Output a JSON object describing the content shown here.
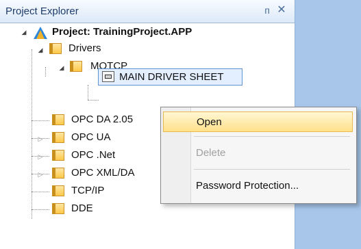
{
  "panel": {
    "title": "Project Explorer",
    "pin_icon": "pin-icon",
    "close_icon": "close-icon",
    "pin_glyph": "ᴨ",
    "close_glyph": "✕"
  },
  "tree": {
    "project_label": "Project: TrainingProject.APP",
    "drivers_label": "Drivers",
    "motcp_label": "MOTCP",
    "main_sheet_label": "MAIN DRIVER SHEET",
    "opc_da_label": "OPC DA 2.05",
    "opc_ua_label": "OPC UA",
    "opc_net_label": "OPC .Net",
    "opc_xmlda_label": "OPC XML/DA",
    "tcpip_label": "TCP/IP",
    "dde_label": "DDE"
  },
  "context_menu": {
    "open_label": "Open",
    "delete_label": "Delete",
    "password_label": "Password Protection..."
  },
  "colors": {
    "accent": "#5f92d1",
    "highlight": "#ffe08a"
  }
}
